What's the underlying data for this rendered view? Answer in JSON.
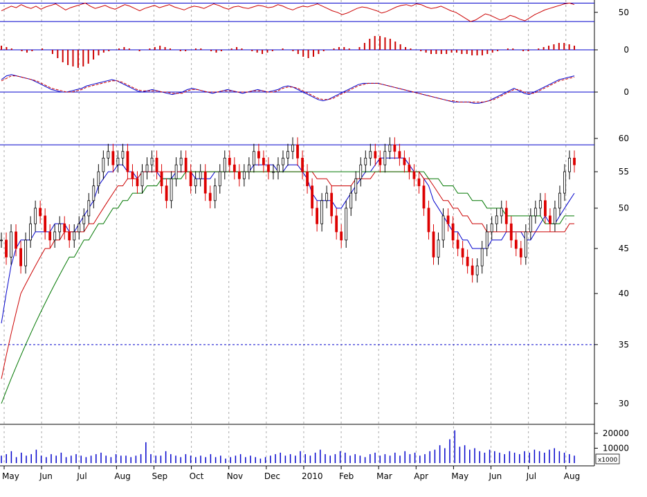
{
  "chart_data": [
    {
      "type": "line",
      "panel": "oscillator-1",
      "description_source": "top panel, red oscillator line",
      "y_tick_labels": [
        "50"
      ],
      "reference_levels": [
        62,
        38
      ],
      "series": [
        {
          "color": "#cc0000",
          "values": [
            52,
            55,
            58,
            56,
            60,
            57,
            55,
            58,
            54,
            57,
            59,
            61,
            57,
            53,
            56,
            58,
            60,
            62,
            58,
            55,
            57,
            59,
            56,
            54,
            57,
            60,
            58,
            55,
            52,
            55,
            57,
            59,
            56,
            58,
            60,
            57,
            55,
            53,
            56,
            58,
            57,
            55,
            58,
            61,
            59,
            56,
            54,
            57,
            58,
            56,
            55,
            57,
            59,
            58,
            56,
            57,
            60,
            58,
            55,
            53,
            56,
            58,
            57,
            59,
            61,
            58,
            55,
            52,
            50,
            47,
            49,
            52,
            55,
            57,
            56,
            54,
            52,
            49,
            51,
            54,
            57,
            59,
            60,
            58,
            61,
            60,
            57,
            55,
            56,
            58,
            55,
            52,
            50,
            46,
            42,
            38,
            40,
            44,
            48,
            46,
            43,
            40,
            42,
            46,
            44,
            41,
            39,
            43,
            47,
            50,
            53,
            55,
            57,
            59,
            61,
            62,
            60
          ]
        }
      ]
    },
    {
      "type": "bar",
      "panel": "histogram",
      "y_tick_labels": [
        "0"
      ],
      "series": [
        {
          "color": "#cc0000",
          "values": [
            3,
            2,
            1,
            0,
            -1,
            -2,
            -1,
            0,
            1,
            0,
            -3,
            -6,
            -9,
            -11,
            -12,
            -13,
            -12,
            -10,
            -7,
            -4,
            -2,
            -1,
            0,
            1,
            2,
            1,
            0,
            -1,
            0,
            1,
            2,
            3,
            2,
            1,
            0,
            -1,
            -1,
            0,
            1,
            1,
            0,
            -1,
            -2,
            -1,
            0,
            1,
            2,
            1,
            0,
            -1,
            -2,
            -3,
            -2,
            -1,
            0,
            1,
            0,
            -1,
            -3,
            -5,
            -6,
            -5,
            -3,
            -1,
            0,
            1,
            2,
            2,
            1,
            0,
            2,
            5,
            8,
            10,
            10,
            9,
            8,
            6,
            4,
            2,
            1,
            0,
            -1,
            -2,
            -3,
            -3,
            -3,
            -3,
            -2,
            -2,
            -3,
            -3,
            -4,
            -4,
            -4,
            -3,
            -2,
            -1,
            0,
            1,
            1,
            0,
            -1,
            -1,
            0,
            1,
            2,
            3,
            4,
            5,
            5,
            4,
            3
          ]
        }
      ]
    },
    {
      "type": "line",
      "panel": "oscillator-2",
      "y_tick_labels": [
        "0"
      ],
      "series": [
        {
          "color": "#0000cc",
          "style": "solid",
          "values": [
            10,
            13,
            14,
            13,
            12,
            11,
            10,
            8,
            6,
            4,
            2,
            1,
            0,
            0,
            1,
            2,
            3,
            5,
            6,
            7,
            8,
            9,
            10,
            9,
            7,
            5,
            3,
            1,
            0,
            1,
            2,
            1,
            0,
            -1,
            -2,
            -1,
            0,
            2,
            3,
            2,
            1,
            0,
            -1,
            0,
            1,
            2,
            1,
            0,
            -1,
            0,
            1,
            2,
            1,
            0,
            1,
            2,
            4,
            5,
            4,
            2,
            0,
            -2,
            -4,
            -6,
            -7,
            -6,
            -4,
            -2,
            0,
            2,
            4,
            6,
            7,
            7,
            7,
            7,
            6,
            5,
            4,
            3,
            2,
            1,
            0,
            -1,
            -2,
            -3,
            -4,
            -5,
            -6,
            -7,
            -8,
            -8,
            -8,
            -8,
            -9,
            -9,
            -8,
            -7,
            -5,
            -3,
            -1,
            1,
            3,
            1,
            -1,
            -2,
            0,
            2,
            4,
            6,
            8,
            10,
            11,
            12,
            13
          ]
        },
        {
          "color": "#cc0000",
          "style": "dashed",
          "values": [
            9,
            11,
            13,
            13,
            12,
            11,
            10,
            9,
            7,
            5,
            3,
            2,
            1,
            0,
            0,
            1,
            2,
            4,
            5,
            6,
            7,
            8,
            9,
            9,
            8,
            6,
            4,
            2,
            1,
            1,
            1,
            1,
            0,
            0,
            -1,
            -1,
            -1,
            1,
            2,
            2,
            1,
            0,
            0,
            0,
            1,
            1,
            1,
            0,
            0,
            0,
            1,
            1,
            1,
            0,
            0,
            1,
            3,
            4,
            4,
            3,
            1,
            -1,
            -3,
            -5,
            -6,
            -6,
            -5,
            -3,
            -1,
            1,
            3,
            5,
            6,
            7,
            7,
            7,
            6,
            5,
            4,
            3,
            2,
            1,
            0,
            -1,
            -2,
            -3,
            -4,
            -5,
            -6,
            -7,
            -7,
            -8,
            -8,
            -8,
            -8,
            -8,
            -8,
            -7,
            -6,
            -4,
            -2,
            0,
            2,
            2,
            0,
            -1,
            -1,
            1,
            3,
            5,
            7,
            9,
            10,
            11,
            12
          ]
        }
      ]
    },
    {
      "type": "candlestick",
      "panel": "price",
      "y_scale": "log",
      "y_tick_labels": [
        "60",
        "55",
        "50",
        "45",
        "40",
        "35",
        "30"
      ],
      "x_tick_labels": [
        "May",
        "Jun",
        "Jul",
        "Aug",
        "Sep",
        "Oct",
        "Nov",
        "Dec",
        "2010",
        "Feb",
        "Mar",
        "Apr",
        "May",
        "Jun",
        "Jul",
        "Aug"
      ],
      "horizontal_line": 59,
      "dashed_line": 35,
      "close_values": [
        46,
        44,
        47,
        45,
        43,
        46,
        48,
        50,
        49,
        47,
        46,
        47,
        48,
        47,
        46,
        47,
        48,
        49,
        51,
        53,
        55,
        57,
        58,
        56,
        57,
        58,
        55,
        54,
        53,
        55,
        56,
        57,
        55,
        53,
        51,
        54,
        56,
        57,
        55,
        53,
        54,
        55,
        52,
        51,
        53,
        55,
        57,
        56,
        55,
        54,
        55,
        56,
        58,
        57,
        56,
        55,
        55,
        56,
        57,
        58,
        59,
        57,
        55,
        53,
        50,
        48,
        51,
        52,
        49,
        47,
        46,
        50,
        52,
        54,
        56,
        57,
        58,
        57,
        56,
        58,
        59,
        58,
        57,
        56,
        55,
        54,
        53,
        50,
        47,
        44,
        46,
        49,
        48,
        46,
        45,
        44,
        43,
        42,
        43,
        45,
        47,
        48,
        49,
        50,
        48,
        46,
        45,
        44,
        47,
        49,
        50,
        51,
        49,
        48,
        50,
        52,
        55,
        57,
        56
      ],
      "moving_averages": [
        {
          "color": "#0000cc",
          "values": [
            37,
            40,
            43,
            45,
            46,
            46,
            46,
            47,
            47,
            47,
            47,
            48,
            48,
            48,
            47,
            47,
            48,
            49,
            50,
            51,
            53,
            54,
            55,
            55,
            56,
            56,
            55,
            55,
            54,
            55,
            55,
            55,
            55,
            54,
            54,
            54,
            55,
            55,
            55,
            55,
            54,
            54,
            54,
            54,
            55,
            55,
            55,
            55,
            55,
            55,
            55,
            55,
            56,
            56,
            56,
            56,
            56,
            55,
            55,
            56,
            56,
            56,
            55,
            54,
            52,
            51,
            51,
            51,
            51,
            50,
            50,
            51,
            52,
            53,
            54,
            55,
            55,
            56,
            57,
            57,
            57,
            57,
            57,
            57,
            56,
            55,
            55,
            54,
            53,
            51,
            50,
            49,
            48,
            47,
            47,
            46,
            46,
            45,
            45,
            45,
            45,
            46,
            46,
            46,
            47,
            47,
            47,
            47,
            46,
            46,
            47,
            48,
            49,
            48,
            48,
            49,
            50,
            51,
            52
          ]
        },
        {
          "color": "#cc0000",
          "values": [
            32,
            34,
            36,
            38,
            40,
            41,
            42,
            43,
            44,
            45,
            45,
            46,
            46,
            47,
            47,
            47,
            47,
            47,
            48,
            48,
            49,
            50,
            51,
            52,
            53,
            53,
            54,
            54,
            54,
            55,
            55,
            55,
            55,
            55,
            55,
            55,
            55,
            55,
            55,
            55,
            55,
            55,
            55,
            55,
            55,
            55,
            55,
            55,
            55,
            55,
            55,
            55,
            55,
            55,
            55,
            55,
            55,
            55,
            55,
            55,
            55,
            55,
            55,
            55,
            55,
            54,
            54,
            54,
            53,
            53,
            53,
            53,
            53,
            54,
            54,
            54,
            54,
            55,
            55,
            55,
            55,
            55,
            55,
            55,
            55,
            55,
            55,
            54,
            54,
            53,
            52,
            51,
            51,
            50,
            50,
            49,
            49,
            48,
            48,
            48,
            47,
            47,
            47,
            47,
            47,
            47,
            47,
            47,
            47,
            47,
            47,
            47,
            47,
            47,
            47,
            47,
            47,
            48,
            48
          ]
        },
        {
          "color": "#007700",
          "values": [
            30,
            31,
            32,
            33,
            34,
            35,
            36,
            37,
            38,
            39,
            40,
            41,
            42,
            43,
            44,
            44,
            45,
            46,
            46,
            47,
            48,
            48,
            49,
            50,
            50,
            51,
            51,
            52,
            52,
            52,
            53,
            53,
            53,
            54,
            54,
            54,
            54,
            54,
            55,
            55,
            55,
            55,
            55,
            55,
            55,
            55,
            55,
            55,
            55,
            55,
            55,
            55,
            55,
            55,
            55,
            55,
            55,
            55,
            55,
            55,
            55,
            55,
            55,
            55,
            55,
            55,
            55,
            55,
            55,
            55,
            55,
            55,
            55,
            55,
            55,
            55,
            55,
            55,
            55,
            55,
            55,
            55,
            55,
            55,
            55,
            55,
            55,
            55,
            54,
            54,
            54,
            53,
            53,
            53,
            52,
            52,
            52,
            51,
            51,
            51,
            50,
            50,
            50,
            50,
            49,
            49,
            49,
            49,
            49,
            49,
            49,
            49,
            48,
            48,
            48,
            48,
            49,
            49,
            49
          ]
        }
      ]
    },
    {
      "type": "bar",
      "panel": "volume",
      "y_tick_labels": [
        "20000",
        "10000"
      ],
      "unit_label": "x1000",
      "series": [
        {
          "color": "#0000cc",
          "values": [
            5000,
            6000,
            8000,
            4000,
            7000,
            5000,
            6000,
            9000,
            5000,
            4000,
            6000,
            5000,
            7000,
            4000,
            5000,
            6000,
            5000,
            4000,
            5000,
            6000,
            7000,
            5000,
            4000,
            6000,
            5000,
            5000,
            4000,
            5000,
            6000,
            14000,
            6000,
            5000,
            5000,
            8000,
            6000,
            5000,
            4000,
            6000,
            5000,
            4000,
            5000,
            4000,
            6000,
            4000,
            5000,
            3000,
            4000,
            5000,
            6000,
            4000,
            5000,
            4000,
            3000,
            4000,
            5000,
            6000,
            7000,
            5000,
            6000,
            5000,
            8000,
            6000,
            5000,
            7000,
            9000,
            6000,
            5000,
            6000,
            8000,
            7000,
            5000,
            6000,
            5000,
            4000,
            6000,
            7000,
            5000,
            6000,
            5000,
            7000,
            5000,
            8000,
            6000,
            7000,
            5000,
            6000,
            8000,
            9000,
            12000,
            10000,
            16000,
            22000,
            11000,
            12000,
            9000,
            10000,
            8000,
            7000,
            9000,
            8000,
            7000,
            6000,
            8000,
            7000,
            6000,
            8000,
            7000,
            9000,
            8000,
            7000,
            9000,
            10000,
            8000,
            7000,
            6000,
            5000
          ]
        }
      ]
    }
  ]
}
